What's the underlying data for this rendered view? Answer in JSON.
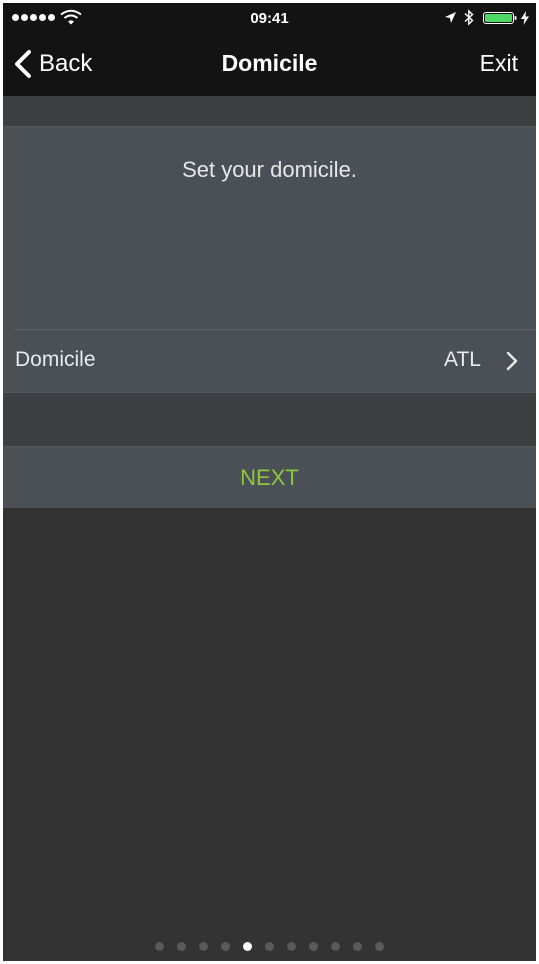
{
  "status_bar": {
    "time": "09:41",
    "signal_icon": "signal-dots-icon",
    "wifi_icon": "wifi-icon",
    "location_icon": "location-arrow-icon",
    "bluetooth_icon": "bluetooth-icon",
    "battery_icon": "battery-icon",
    "battery_color": "#4cd964"
  },
  "nav": {
    "back_label": "Back",
    "title": "Domicile",
    "exit_label": "Exit"
  },
  "card": {
    "prompt": "Set your domicile.",
    "row_label": "Domicile",
    "row_value": "ATL"
  },
  "next_label": "NEXT",
  "colors": {
    "accent": "#8dc63f",
    "background": "#333333",
    "card": "#4b5057"
  },
  "pager": {
    "total": 11,
    "current": 5
  }
}
